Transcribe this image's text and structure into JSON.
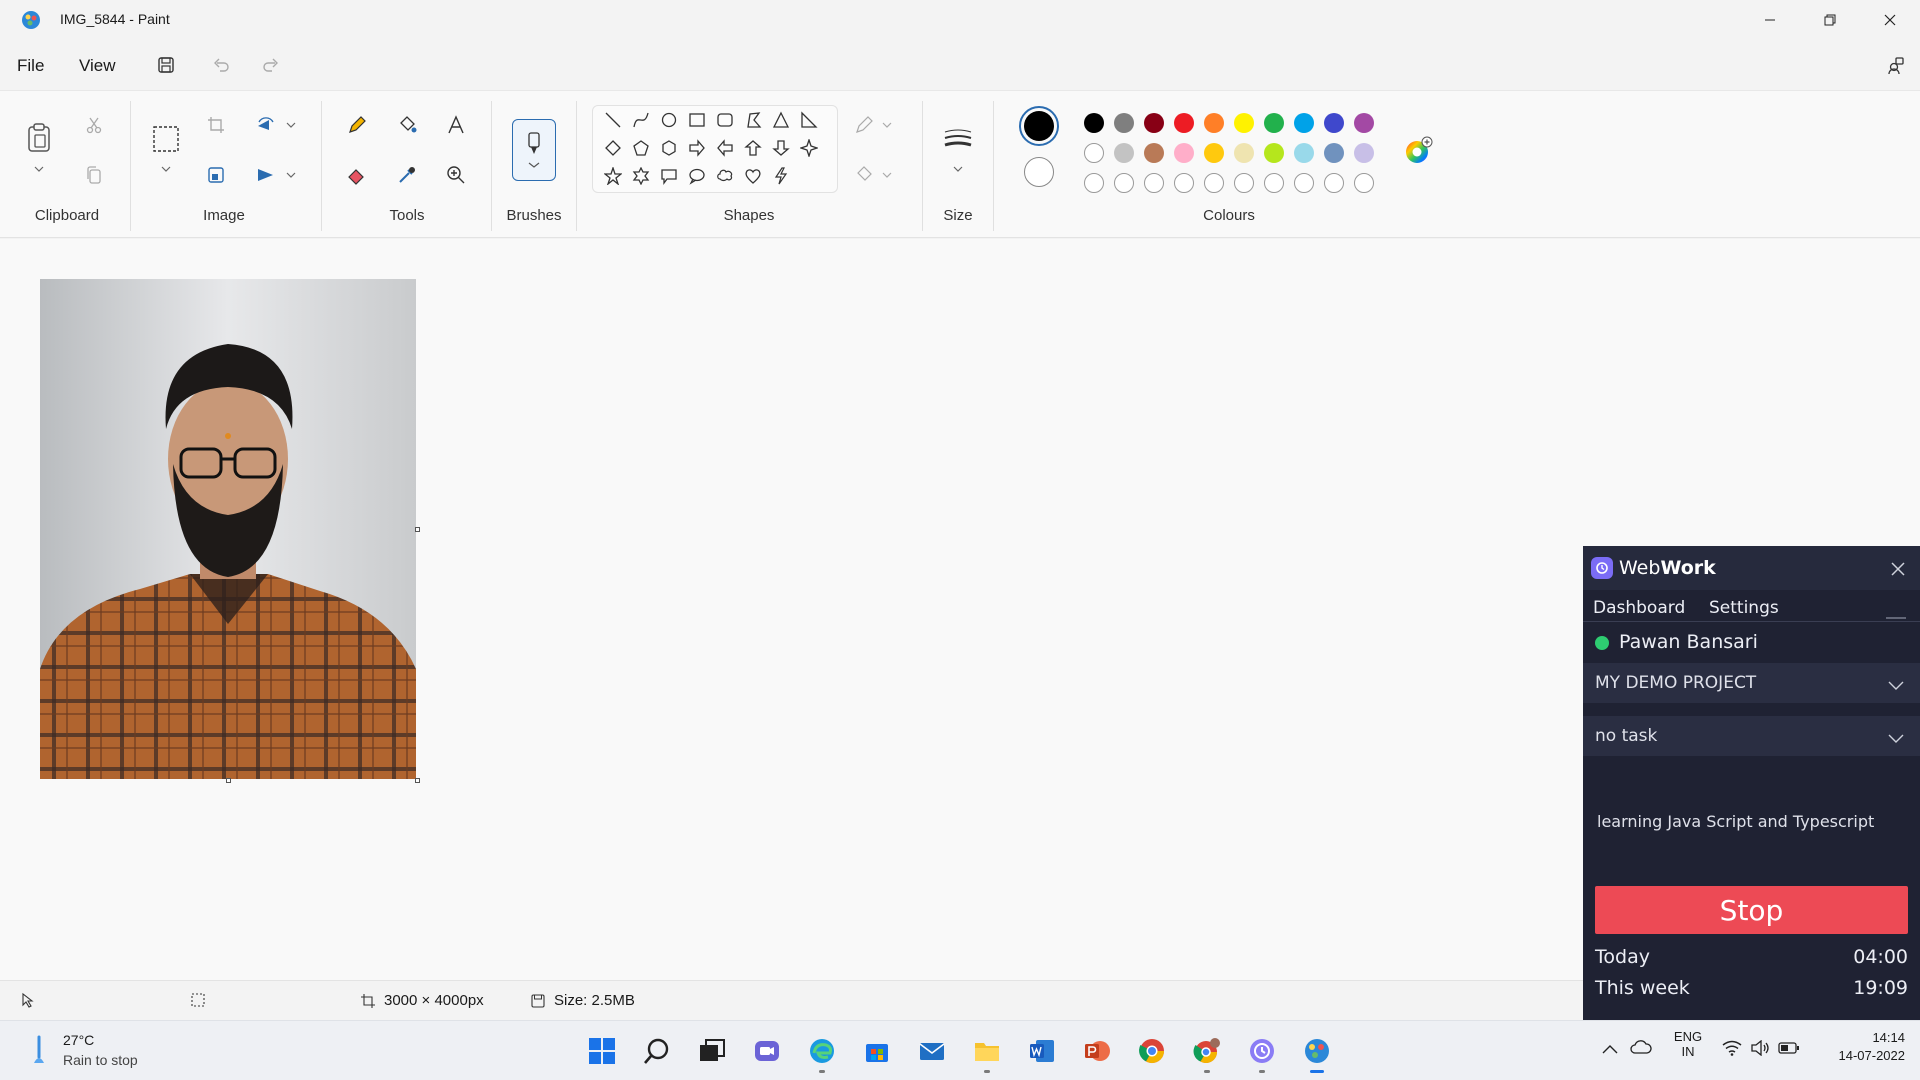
{
  "window": {
    "title": "IMG_5844 - Paint"
  },
  "menu": {
    "file": "File",
    "view": "View"
  },
  "ribbon": {
    "groups": {
      "clipboard": "Clipboard",
      "image": "Image",
      "tools": "Tools",
      "brushes": "Brushes",
      "shapes": "Shapes",
      "size": "Size",
      "colours": "Colours"
    }
  },
  "colours": {
    "primary": "#000000",
    "secondary": "#ffffff",
    "row1": [
      "#000000",
      "#7f7f7f",
      "#880015",
      "#ed1c24",
      "#ff7f27",
      "#fff200",
      "#22b14c",
      "#00a2e8",
      "#3f48cc",
      "#a349a4"
    ],
    "row2": [
      "#ffffff",
      "#c3c3c3",
      "#b97a57",
      "#ffaec9",
      "#ffc90e",
      "#efe4b0",
      "#b5e61d",
      "#99d9ea",
      "#7092be",
      "#c8bfe7"
    ]
  },
  "status": {
    "dimensions": "3000 × 4000px",
    "size": "Size: 2.5MB"
  },
  "taskbar": {
    "weather_temp": "27°C",
    "weather_desc": "Rain to stop",
    "lang": "ENG",
    "region": "IN",
    "time": "14:14",
    "date": "14-07-2022"
  },
  "webwork": {
    "brand_prefix": "Web",
    "brand_suffix": "Work",
    "nav_dashboard": "Dashboard",
    "nav_settings": "Settings",
    "user": "Pawan Bansari",
    "project": "MY DEMO PROJECT",
    "task": "no task",
    "note": "learning Java Script and Typescript",
    "stop": "Stop",
    "today_label": "Today",
    "today_value": "04:00",
    "week_label": "This week",
    "week_value": "19:09",
    "accent": "#ed4a55"
  }
}
